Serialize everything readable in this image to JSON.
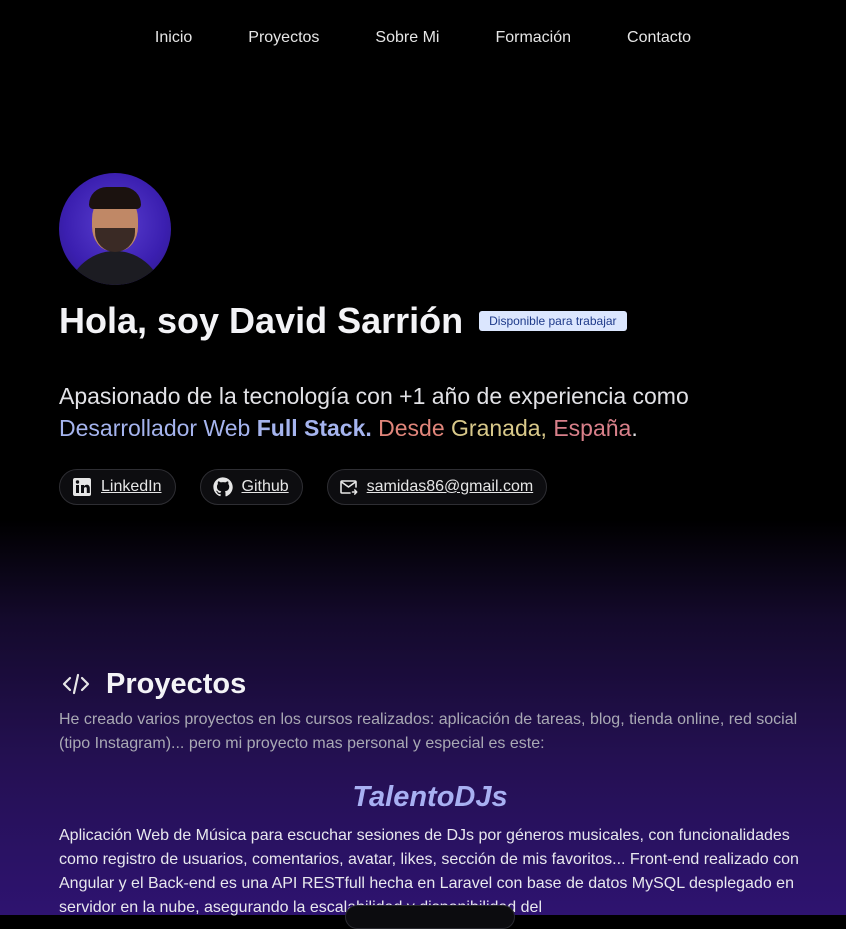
{
  "nav": {
    "items": [
      "Inicio",
      "Proyectos",
      "Sobre Mi",
      "Formación",
      "Contacto"
    ]
  },
  "hero": {
    "title": "Hola, soy David Sarrión",
    "badge": "Disponible para trabajar",
    "intro_text": "Apasionado de la tecnología con +1 año de experiencia como",
    "intro_dev": "Desarrollador Web",
    "intro_fullstack": "Full Stack.",
    "intro_from": "Desde",
    "intro_city": "Granada,",
    "intro_country": "España",
    "intro_end": "."
  },
  "links": {
    "linkedin": "LinkedIn",
    "github": "Github",
    "email": "samidas86@gmail.com"
  },
  "projects": {
    "title": "Proyectos",
    "description": "He creado varios proyectos en los cursos realizados: aplicación de tareas, blog, tienda online, red social (tipo Instagram)... pero mi proyecto mas personal y especial es este:",
    "featured_name": "TalentoDJs",
    "featured_description": "Aplicación Web de Música para escuchar sesiones de DJs por géneros musicales, con funcionalidades como registro de usuarios, comentarios, avatar, likes, sección de mis favoritos... Front-end realizado con Angular y el Back-end es una API RESTfull hecha en Laravel con base de datos MySQL desplegado en servidor en la nube, asegurando la escalabilidad y disponibilidad del"
  },
  "icons": {
    "linkedin": "linkedin-icon",
    "github": "github-icon",
    "email": "mail-icon",
    "projects": "code-icon"
  },
  "colors": {
    "accent": "#a5b4ee",
    "badge_bg": "#dbe6fe",
    "badge_text": "#1e3a8a",
    "from": "#e0857a",
    "city": "#d9c98a",
    "country": "#d9808a"
  }
}
